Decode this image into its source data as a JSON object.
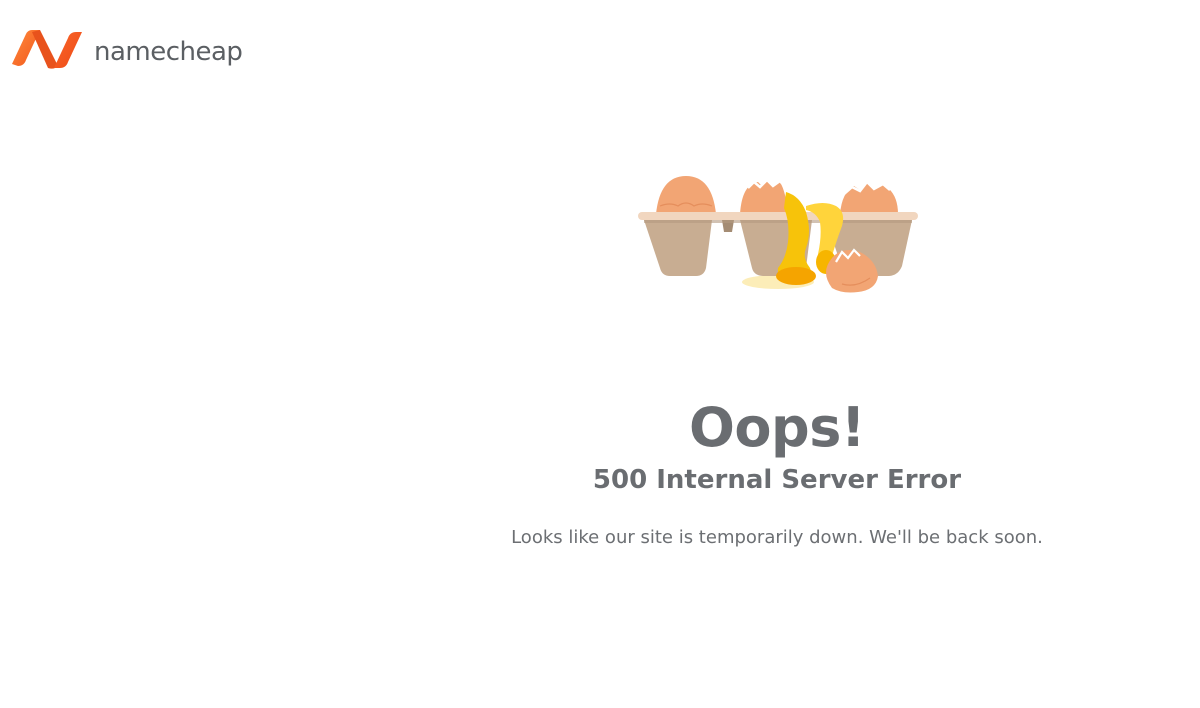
{
  "brand": {
    "name": "namecheap",
    "logo_icon": "namecheap-n-logo",
    "accent_color": "#f26b21"
  },
  "illustration": {
    "icon": "broken-eggs-carton-icon"
  },
  "error": {
    "title": "Oops!",
    "subtitle": "500 Internal Server Error",
    "message": "Looks like our site is temporarily down. We'll be back soon."
  }
}
